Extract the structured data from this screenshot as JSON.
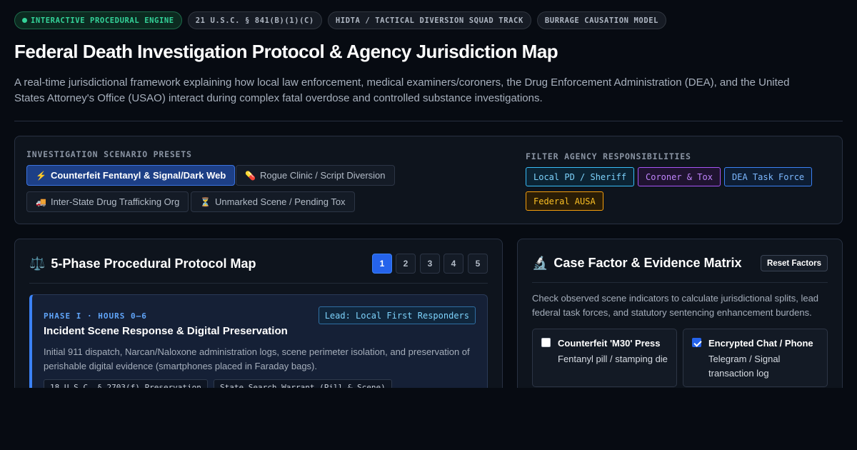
{
  "badges": [
    {
      "label": "INTERACTIVE PROCEDURAL ENGINE"
    },
    {
      "label": "21 U.S.C. § 841(B)(1)(C)"
    },
    {
      "label": "HIDTA / TACTICAL DIVERSION SQUAD TRACK"
    },
    {
      "label": "BURRAGE CAUSATION MODEL"
    }
  ],
  "header": {
    "title": "Federal Death Investigation Protocol & Agency Jurisdiction Map",
    "subtitle": "A real-time jurisdictional framework explaining how local law enforcement, medical examiners/coroners, the Drug Enforcement Administration (DEA), and the United States Attorney's Office (USAO) interact during complex fatal overdose and controlled substance investigations."
  },
  "presets": {
    "label": "INVESTIGATION SCENARIO PRESETS",
    "items": [
      {
        "icon": "⚡",
        "icon_name": "lightning-icon",
        "label": "Counterfeit Fentanyl & Signal/Dark Web",
        "active": true
      },
      {
        "icon": "💊",
        "icon_name": "pill-icon",
        "label": "Rogue Clinic / Script Diversion",
        "active": false
      },
      {
        "icon": "🚚",
        "icon_name": "truck-icon",
        "label": "Inter-State Drug Trafficking Org",
        "active": false
      },
      {
        "icon": "⏳",
        "icon_name": "hourglass-icon",
        "label": "Unmarked Scene / Pending Tox",
        "active": false
      }
    ]
  },
  "filters": {
    "label": "FILTER AGENCY RESPONSIBILITIES",
    "items": [
      {
        "label": "Local PD / Sheriff",
        "color": "#38bdf8"
      },
      {
        "label": "Coroner & Tox",
        "color": "#a855f7"
      },
      {
        "label": "DEA Task Force",
        "color": "#3b82f6"
      },
      {
        "label": "Federal AUSA",
        "color": "#f59e0b"
      }
    ]
  },
  "protocol": {
    "icon": "⚖️",
    "icon_name": "scales-icon",
    "title": "5-Phase Procedural Protocol Map",
    "phases": [
      "1",
      "2",
      "3",
      "4",
      "5"
    ],
    "active_phase": "1",
    "current": {
      "label": "PHASE I · HOURS 0–6",
      "lead": "Lead: Local First Responders",
      "title": "Incident Scene Response & Digital Preservation",
      "description": "Initial 911 dispatch, Narcan/Naloxone administration logs, scene perimeter isolation, and preservation of perishable digital evidence (smartphones placed in Faraday bags).",
      "tags": [
        "18 U.S.C. § 2703(f) Preservation",
        "State Search Warrant (Pill & Scene)"
      ]
    }
  },
  "matrix": {
    "icon": "🔬",
    "icon_name": "microscope-icon",
    "title": "Case Factor & Evidence Matrix",
    "reset_label": "Reset Factors",
    "description": "Check observed scene indicators to calculate jurisdictional splits, lead federal task forces, and statutory sentencing enhancement burdens.",
    "factors": [
      {
        "title": "Counterfeit 'M30' Press",
        "detail": "Fentanyl pill / stamping die",
        "checked": false
      },
      {
        "title": "Encrypted Chat / Phone",
        "detail": "Telegram / Signal transaction log",
        "checked": true
      }
    ]
  },
  "colors": {
    "background": "#070b12",
    "panel": "#0e141d",
    "accent_blue": "#2563eb",
    "status_green": "#34d399"
  }
}
